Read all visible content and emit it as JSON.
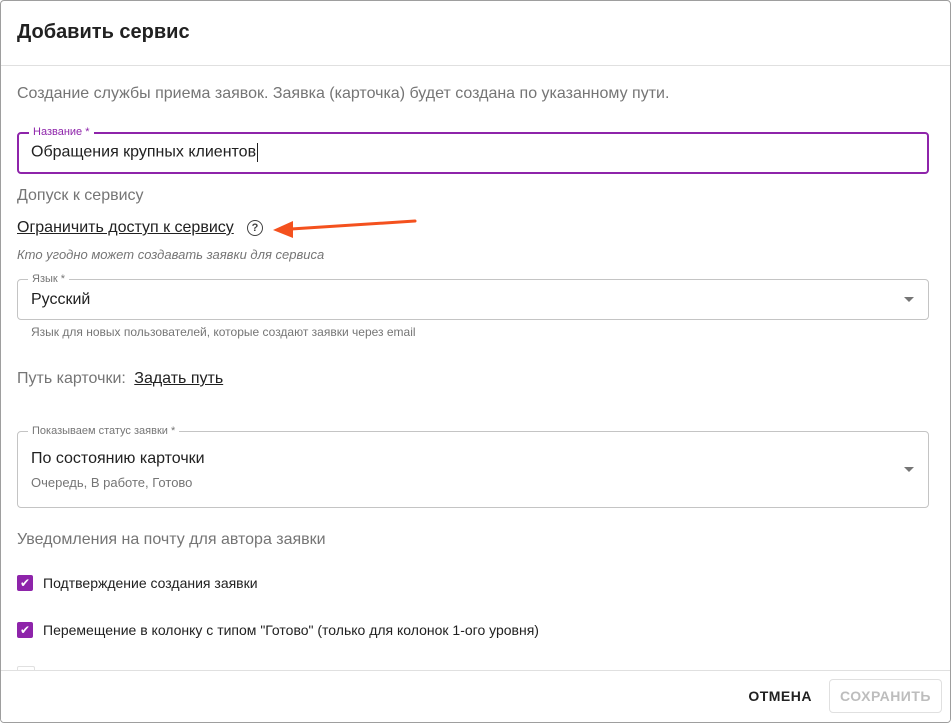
{
  "dialog": {
    "title": "Добавить сервис",
    "description": "Создание службы приема заявок. Заявка (карточка) будет создана по указанному пути."
  },
  "name_field": {
    "label": "Название *",
    "value": "Обращения крупных клиентов"
  },
  "access": {
    "section_label": "Допуск к сервису",
    "restrict_link": "Ограничить доступ к сервису",
    "help_icon": "question-circle-icon",
    "hint": "Кто угодно может создавать заявки для сервиса"
  },
  "language_field": {
    "label": "Язык *",
    "value": "Русский",
    "helper": "Язык для новых пользователей, которые создают заявки через email"
  },
  "card_path": {
    "label": "Путь карточки:",
    "link": "Задать путь"
  },
  "status_field": {
    "label": "Показываем статус заявки *",
    "value": "По состоянию карточки",
    "subtext": "Очередь, В работе, Готово"
  },
  "notifications": {
    "section_label": "Уведомления на почту для автора заявки",
    "items": [
      {
        "label": "Подтверждение создания заявки",
        "checked": true
      },
      {
        "label": "Перемещение в колонку с типом \"Готово\" (только для колонок 1-ого уровня)",
        "checked": true
      }
    ]
  },
  "footer": {
    "cancel_label": "ОТМЕНА",
    "save_label": "СОХРАНИТЬ"
  },
  "colors": {
    "accent": "#8e24aa",
    "annotation_arrow": "#f4511e"
  }
}
